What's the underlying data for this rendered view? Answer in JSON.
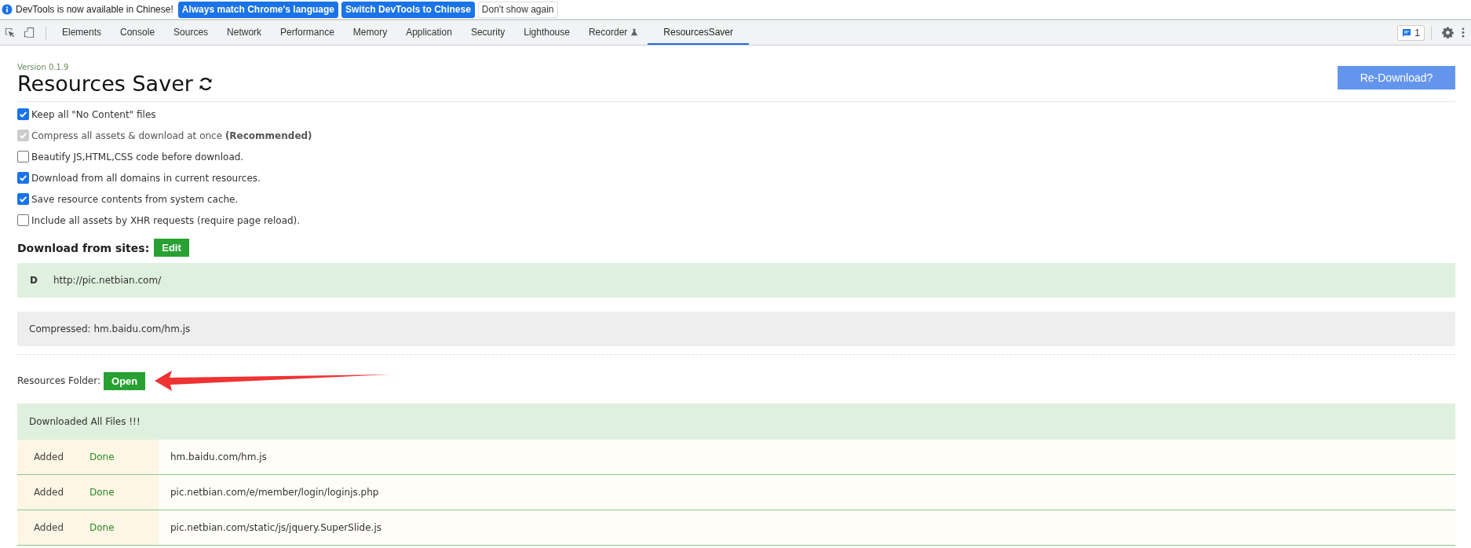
{
  "infobar": {
    "message": "DevTools is now available in Chinese!",
    "buttons": [
      {
        "label": "Always match Chrome's language",
        "kind": "primary"
      },
      {
        "label": "Switch DevTools to Chinese",
        "kind": "primary"
      },
      {
        "label": "Don't show again",
        "kind": "plain"
      }
    ]
  },
  "tabs": [
    {
      "label": "Elements",
      "selected": false
    },
    {
      "label": "Console",
      "selected": false
    },
    {
      "label": "Sources",
      "selected": false
    },
    {
      "label": "Network",
      "selected": false
    },
    {
      "label": "Performance",
      "selected": false
    },
    {
      "label": "Memory",
      "selected": false
    },
    {
      "label": "Application",
      "selected": false
    },
    {
      "label": "Security",
      "selected": false
    },
    {
      "label": "Lighthouse",
      "selected": false
    },
    {
      "label": "Recorder",
      "selected": false,
      "kind": "experimental"
    },
    {
      "label": "ResourcesSaver",
      "selected": true
    }
  ],
  "issues_badge": "1",
  "panel": {
    "version": "Version 0.1.9",
    "title": "Resources Saver",
    "redownload": "Re-Download?",
    "options": [
      {
        "label": "Keep all \"No Content\" files",
        "checked": true,
        "disabled": false
      },
      {
        "label": "Compress all assets & download at once **(Recommended)**",
        "checked": true,
        "disabled": true
      },
      {
        "label": "Beautify JS,HTML,CSS code before download.",
        "checked": false,
        "disabled": false
      },
      {
        "label": "Download from all domains in current resources.",
        "checked": true,
        "disabled": false
      },
      {
        "label": "Save resource contents from system cache.",
        "checked": true,
        "disabled": false
      },
      {
        "label": "Include all assets by XHR requests (require page reload).",
        "checked": false,
        "disabled": false
      }
    ],
    "sites_label": "Download from sites:",
    "edit": "Edit",
    "sites": [
      {
        "letter": "D",
        "url": "http://pic.netbian.com/"
      }
    ],
    "compressed": "Compressed: hm.baidu.com/hm.js",
    "folder_label": "Resources Folder:",
    "open": "Open",
    "status": "Downloaded All Files !!!",
    "files": [
      {
        "added": "Added",
        "state": "Done",
        "url": "hm.baidu.com/hm.js"
      },
      {
        "added": "Added",
        "state": "Done",
        "url": "pic.netbian.com/e/member/login/loginjs.php"
      },
      {
        "added": "Added",
        "state": "Done",
        "url": "pic.netbian.com/static/js/jquery.SuperSlide.js"
      }
    ]
  }
}
